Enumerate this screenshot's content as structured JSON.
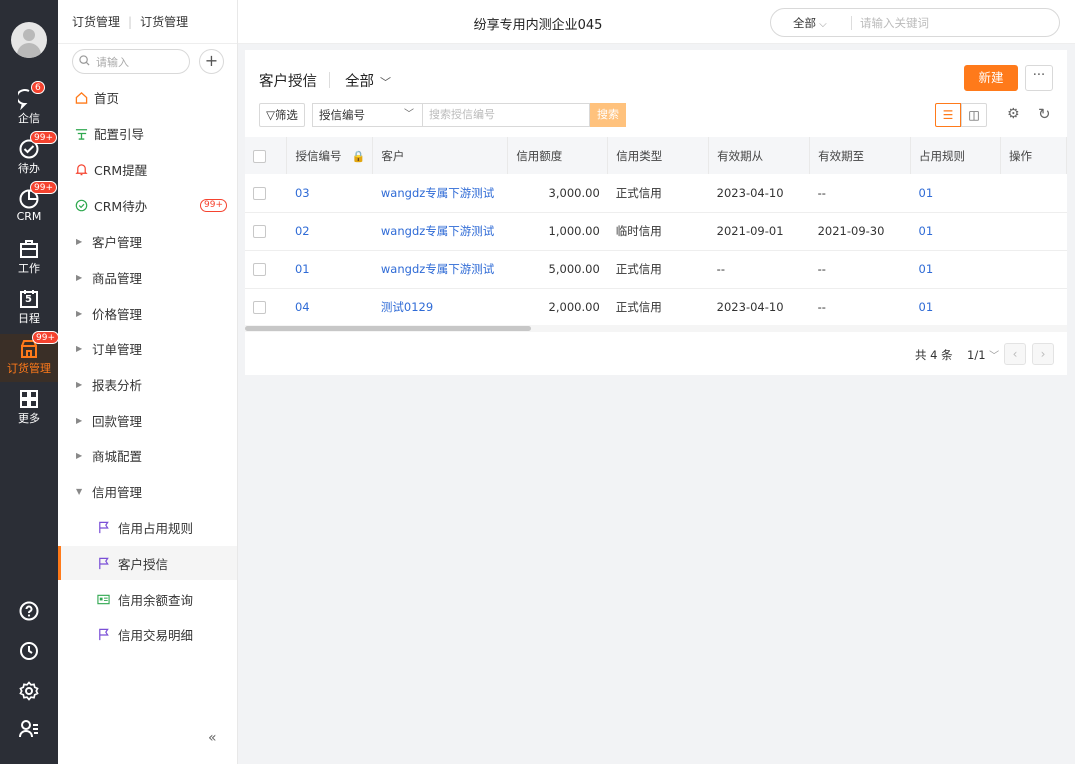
{
  "rail": {
    "items": [
      {
        "label": "企信",
        "badge": "6",
        "icon": "chat-bubble-icon"
      },
      {
        "label": "待办",
        "badge": "99+",
        "icon": "check-circle-icon"
      },
      {
        "label": "CRM",
        "badge": "99+",
        "icon": "pie-chart-icon"
      },
      {
        "label": "工作",
        "badge": "",
        "icon": "briefcase-icon"
      },
      {
        "label": "日程",
        "badge": "",
        "day": "5",
        "icon": "calendar-icon"
      },
      {
        "label": "订货管理",
        "badge": "99+",
        "icon": "shop-icon"
      },
      {
        "label": "更多",
        "badge": "",
        "icon": "grid-icon"
      }
    ]
  },
  "nav": {
    "breadcrumb_app": "订货管理",
    "breadcrumb_current": "订货管理",
    "search_placeholder": "请输入",
    "items": [
      {
        "label": "首页"
      },
      {
        "label": "配置引导"
      },
      {
        "label": "CRM提醒"
      },
      {
        "label": "CRM待办",
        "badge": "99+"
      },
      {
        "label": "客户管理"
      },
      {
        "label": "商品管理"
      },
      {
        "label": "价格管理"
      },
      {
        "label": "订单管理"
      },
      {
        "label": "报表分析"
      },
      {
        "label": "回款管理"
      },
      {
        "label": "商城配置"
      },
      {
        "label": "信用管理"
      },
      {
        "label": "信用占用规则"
      },
      {
        "label": "客户授信"
      },
      {
        "label": "信用余额查询"
      },
      {
        "label": "信用交易明细"
      }
    ]
  },
  "topbar": {
    "company": "纷享专用内测企业045",
    "search_scope": "全部",
    "search_placeholder": "请输入关键词"
  },
  "page": {
    "title": "客户授信",
    "view": "全部",
    "new_label": "新建",
    "more_label": "···",
    "filter_label": "筛选",
    "field_select": "授信编号",
    "keyword_placeholder": "搜索授信编号",
    "search_label": "搜索"
  },
  "table": {
    "columns": [
      "授信编号",
      "客户",
      "信用额度",
      "信用类型",
      "有效期从",
      "有效期至",
      "占用规则",
      "操作"
    ],
    "rows": [
      {
        "code": "03",
        "customer": "wangdz专属下游测试",
        "amount": "3,000.00",
        "type": "正式信用",
        "from": "2023-04-10",
        "to": "--",
        "rule": "01"
      },
      {
        "code": "02",
        "customer": "wangdz专属下游测试",
        "amount": "1,000.00",
        "type": "临时信用",
        "from": "2021-09-01",
        "to": "2021-09-30",
        "rule": "01"
      },
      {
        "code": "01",
        "customer": "wangdz专属下游测试",
        "amount": "5,000.00",
        "type": "正式信用",
        "from": "--",
        "to": "--",
        "rule": "01"
      },
      {
        "code": "04",
        "customer": "测试0129",
        "amount": "2,000.00",
        "type": "正式信用",
        "from": "2023-04-10",
        "to": "--",
        "rule": "01"
      }
    ]
  },
  "pager": {
    "total": "共 4 条",
    "pages": "1/1"
  },
  "colors": {
    "accent": "#ff7a1a",
    "link": "#2f6bd6",
    "rail_bg": "#2b2e36",
    "badge": "#f5432f"
  }
}
